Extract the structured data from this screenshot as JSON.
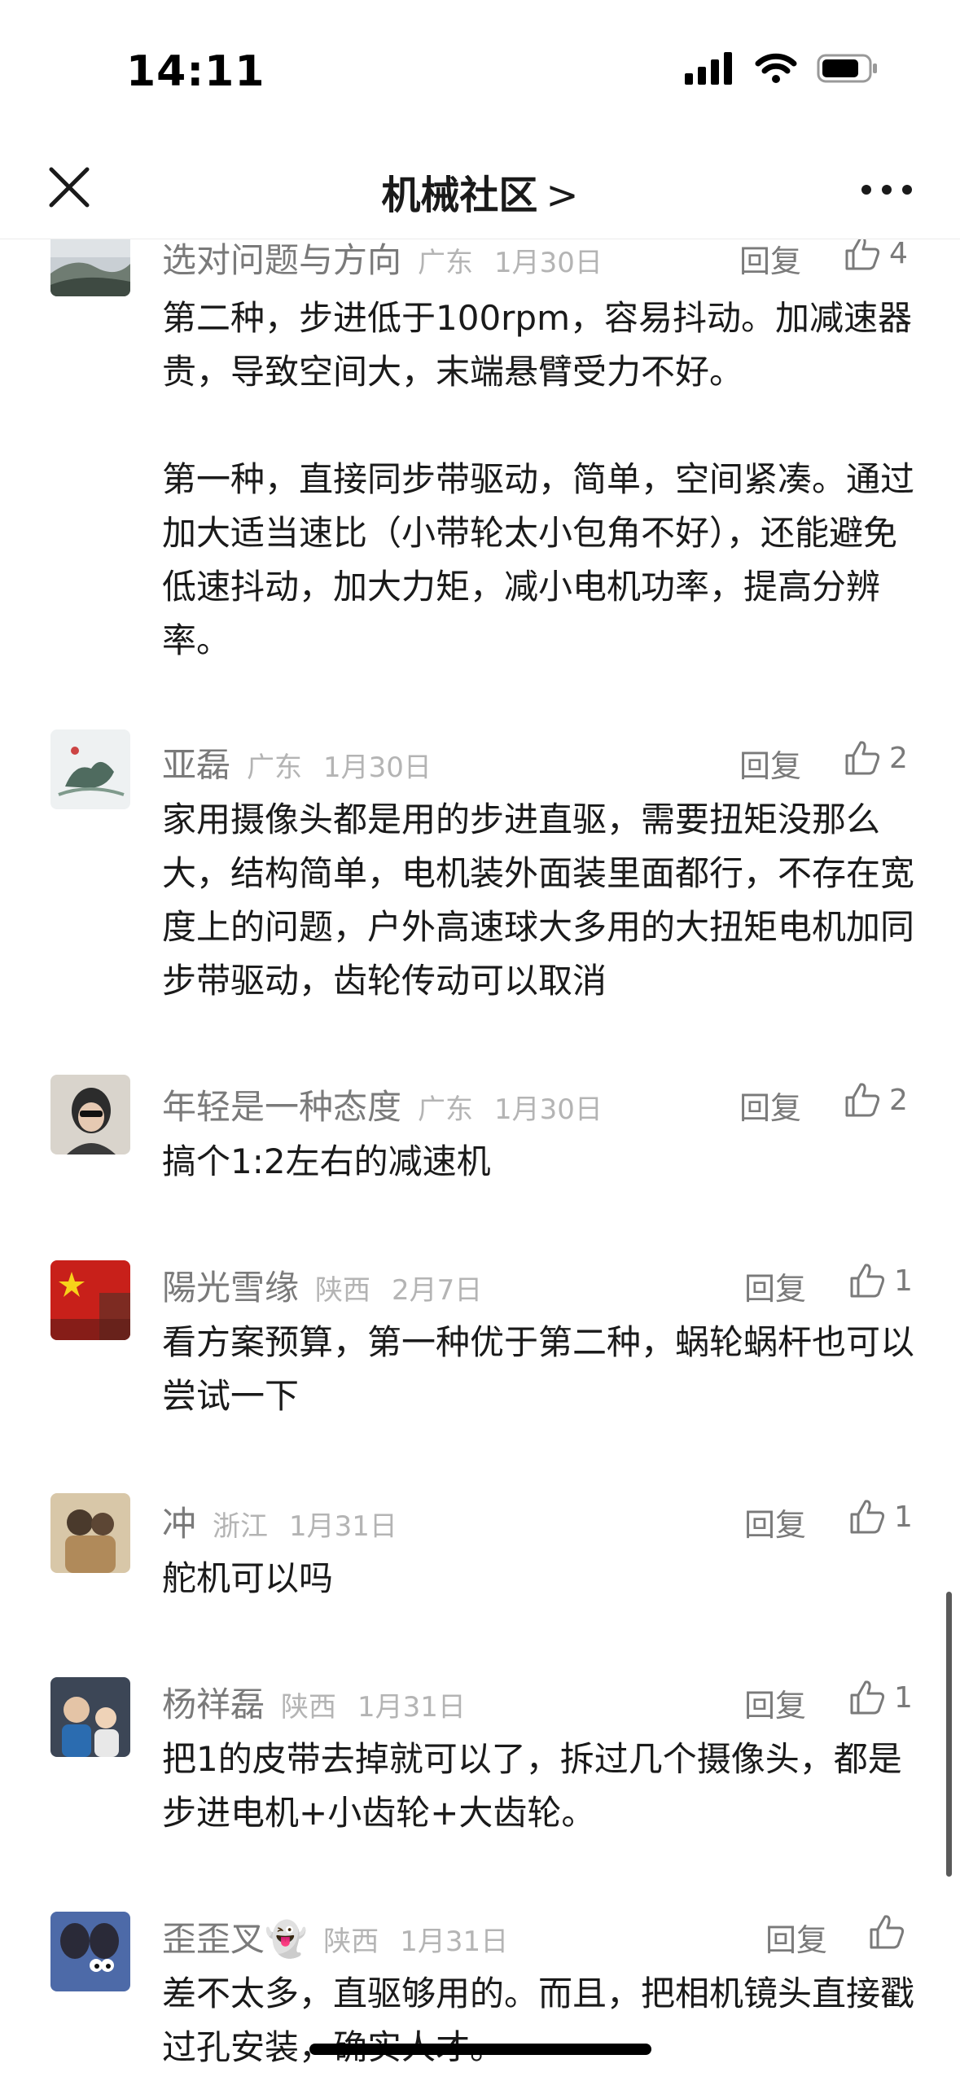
{
  "status_bar": {
    "time": "14:11"
  },
  "nav": {
    "title": "机械社区",
    "chevron": ">"
  },
  "comments": [
    {
      "username": "选对问题与方向",
      "region": "广东",
      "date": "1月30日",
      "reply_label": "回复",
      "likes": "4",
      "paragraphs": [
        "第二种，步进低于100rpm，容易抖动。加减速器贵，导致空间大，末端悬臂受力不好。",
        "",
        "第一种，直接同步带驱动，简单，空间紧凑。通过加大适当速比（小带轮太小包角不好），还能避免低速抖动，加大力矩，减小电机功率，提高分辨率。"
      ]
    },
    {
      "username": "亚磊",
      "region": "广东",
      "date": "1月30日",
      "reply_label": "回复",
      "likes": "2",
      "paragraphs": [
        "家用摄像头都是用的步进直驱，需要扭矩没那么大，结构简单，电机装外面装里面都行，不存在宽度上的问题，户外高速球大多用的大扭矩电机加同步带驱动，齿轮传动可以取消"
      ]
    },
    {
      "username": "年轻是一种态度",
      "region": "广东",
      "date": "1月30日",
      "reply_label": "回复",
      "likes": "2",
      "paragraphs": [
        "搞个1:2左右的减速机"
      ]
    },
    {
      "username": "陽光雪缘",
      "region": "陕西",
      "date": "2月7日",
      "reply_label": "回复",
      "likes": "1",
      "paragraphs": [
        "看方案预算，第一种优于第二种，蜗轮蜗杆也可以尝试一下"
      ]
    },
    {
      "username": "冲",
      "region": "浙江",
      "date": "1月31日",
      "reply_label": "回复",
      "likes": "1",
      "paragraphs": [
        "舵机可以吗"
      ]
    },
    {
      "username": "杨祥磊",
      "region": "陕西",
      "date": "1月31日",
      "reply_label": "回复",
      "likes": "1",
      "paragraphs": [
        "把1的皮带去掉就可以了，拆过几个摄像头，都是步进电机+小齿轮+大齿轮。"
      ]
    },
    {
      "username": "歪歪叉👻",
      "region": "陕西",
      "date": "1月31日",
      "reply_label": "回复",
      "likes": "",
      "paragraphs": [
        "差不太多，直驱够用的。而且，把相机镜头直接戳过孔安装，确实人才。"
      ]
    }
  ]
}
